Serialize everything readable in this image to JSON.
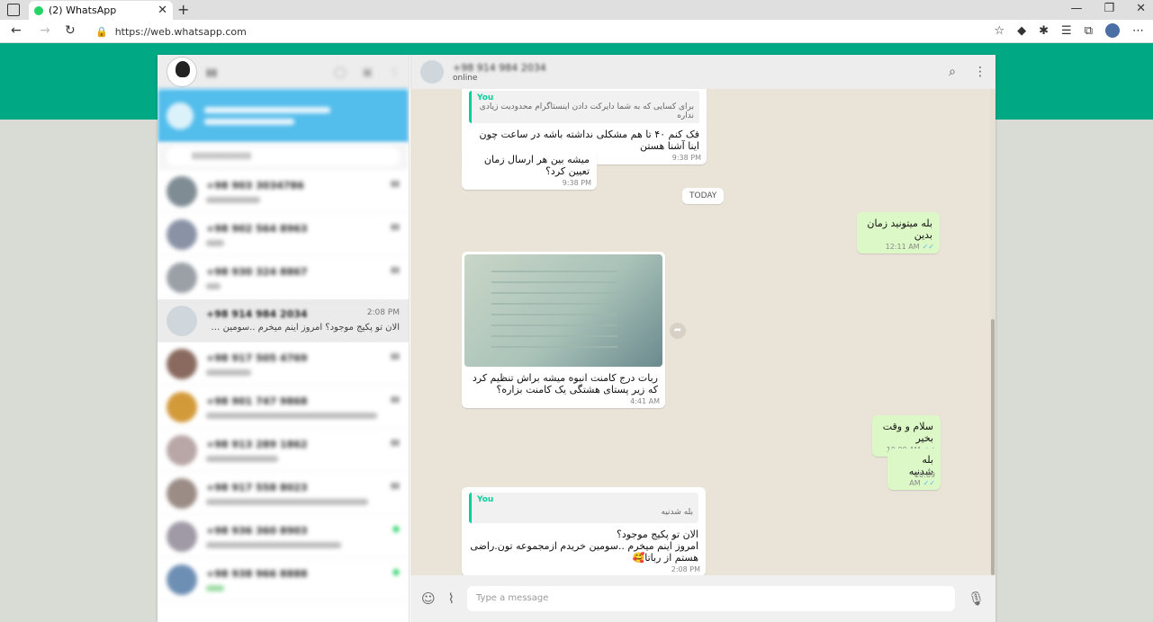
{
  "browser": {
    "tab_title": "(2) WhatsApp",
    "url": "https://web.whatsapp.com"
  },
  "conversation": {
    "contact_name": "+98 914 984 2034",
    "contact_status": "online",
    "compose_placeholder": "Type a message"
  },
  "chats": [
    {
      "name": "+98 903 3034786",
      "time": "",
      "preview": ""
    },
    {
      "name": "+98 902 564 8963",
      "time": "",
      "preview": ""
    },
    {
      "name": "+98 930 324 8867",
      "time": "",
      "preview": ""
    },
    {
      "name": "+98 914 984 2034",
      "time": "2:08 PM",
      "preview": "الان تو پکیج موجود؟ امروز اینم میخرم ..سومین خریدم ..."
    },
    {
      "name": "+98 917 505 4769",
      "time": "",
      "preview": ""
    },
    {
      "name": "+98 901 747 9868",
      "time": "",
      "preview": ""
    },
    {
      "name": "+98 913 289 1862",
      "time": "",
      "preview": ""
    },
    {
      "name": "+98 917 558 8023",
      "time": "",
      "preview": ""
    },
    {
      "name": "+98 936 360 8903",
      "time": "",
      "preview": ""
    },
    {
      "name": "+98 938 966 8888",
      "time": "",
      "preview": ""
    }
  ],
  "messages": {
    "m1_quote_author": "You",
    "m1_quote_text": "برای کسایی که به شما دایرکت دادن اینستاگرام محدودیت زیادی نداره",
    "m1_text": "فک کنم ۴۰ تا هم مشکلی نداشته باشه در ساعت چون اینا آشنا هستن",
    "m1_time": "9:38 PM",
    "m2_text": "میشه بین هر ارسال زمان تعیین کرد؟",
    "m2_time": "9:38 PM",
    "date_label": "TODAY",
    "m3_text": "بله میتونید زمان بدین",
    "m3_time": "12:11 AM",
    "m4_text": "ربات درج کامنت انبوه میشه براش تنظیم کرد که زیر پستای هشتگی یک کامنت بزاره؟",
    "m4_time": "4:41 AM",
    "m5_text": "سلام و وقت بخیر",
    "m5_time": "10:09 AM",
    "m6_text": "بله شدنیه",
    "m6_time": "10:09 AM",
    "m7_quote_author": "You",
    "m7_quote_text": "بله شدنیه",
    "m7_line1": "الان تو پکیج موجود؟",
    "m7_line2": "امروز اینم میخرم ..سومین خریدم ازمجموعه تون.راضی هستم از رباتا🥰",
    "m7_time": "2:08 PM"
  }
}
